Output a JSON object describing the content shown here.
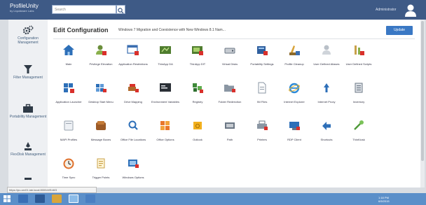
{
  "header": {
    "logo_title": "ProfileUnity",
    "logo_subtitle": "by Liquidware Labs",
    "search_placeholder": "Search",
    "user_name": "Administrator"
  },
  "sidebar": {
    "items": [
      {
        "label": "Configuration Management",
        "icon": "gears-icon"
      },
      {
        "label": "Filter Management",
        "icon": "filter-icon"
      },
      {
        "label": "Portability Management",
        "icon": "briefcase-icon"
      },
      {
        "label": "FlexDisk Management",
        "icon": "flexdisk-icon"
      },
      {
        "label": "",
        "icon": "more-icon"
      }
    ]
  },
  "main": {
    "title": "Edit Configuration",
    "subtitle": "Windows 7 Migration and Coexistence with New Windows 8.1 Nam...",
    "update_label": "Update",
    "tiles": [
      {
        "label": "Main",
        "icon": "house-icon"
      },
      {
        "label": "Privilege Elevation",
        "icon": "privilege-elevation-icon"
      },
      {
        "label": "Application Restrictions",
        "icon": "application-restrictions-icon"
      },
      {
        "label": "ThinApp DA",
        "icon": "thinapp-icon"
      },
      {
        "label": "ThinApp DIT",
        "icon": "thinapp-dit-icon"
      },
      {
        "label": "Virtual Disks",
        "icon": "virtual-disk-icon"
      },
      {
        "label": "Portability Settings",
        "icon": "portability-settings-icon"
      },
      {
        "label": "Profile Cleanup",
        "icon": "profile-cleanup-icon"
      },
      {
        "label": "User Defined Aliases",
        "icon": "user-defined-aliases-icon"
      },
      {
        "label": "User Defined Scripts",
        "icon": "user-defined-scripts-icon"
      },
      {
        "label": "Application Launcher",
        "icon": "application-launcher-icon"
      },
      {
        "label": "Desktop Start Menu",
        "icon": "desktop-start-menu-icon"
      },
      {
        "label": "Drive Mapping",
        "icon": "drive-mapping-icon"
      },
      {
        "label": "Environment Variables",
        "icon": "environment-variables-icon"
      },
      {
        "label": "Registry",
        "icon": "registry-icon"
      },
      {
        "label": "Folder Redirection",
        "icon": "folder-redirection-icon"
      },
      {
        "label": "INI Files",
        "icon": "ini-files-icon"
      },
      {
        "label": "Internet Explorer",
        "icon": "internet-explorer-icon"
      },
      {
        "label": "Internet Proxy",
        "icon": "internet-proxy-icon"
      },
      {
        "label": "Inventory",
        "icon": "inventory-icon"
      },
      {
        "label": "MAPI Profiles",
        "icon": "mapi-profiles-icon"
      },
      {
        "label": "Message Boxes",
        "icon": "message-boxes-icon"
      },
      {
        "label": "Office File Locations",
        "icon": "office-file-locations-icon"
      },
      {
        "label": "Office Options",
        "icon": "office-options-icon"
      },
      {
        "label": "Outlook",
        "icon": "outlook-icon"
      },
      {
        "label": "Path",
        "icon": "path-icon"
      },
      {
        "label": "Printers",
        "icon": "printers-icon"
      },
      {
        "label": "RDP Client",
        "icon": "rdp-client-icon"
      },
      {
        "label": "Shortcuts",
        "icon": "shortcuts-icon"
      },
      {
        "label": "ThinKiosk",
        "icon": "thinkiosk-icon"
      },
      {
        "label": "Time Sync",
        "icon": "time-sync-icon"
      },
      {
        "label": "Trigger Points",
        "icon": "trigger-points-icon"
      },
      {
        "label": "Windows Options",
        "icon": "windows-options-icon"
      }
    ]
  },
  "status_url": "https://pu-srv01.lab.local:8000/#/Edit/3",
  "tray": {
    "time": "1:18 PM",
    "date": "6/5/2015"
  },
  "colors": {
    "topbar": "#3e5a86",
    "accent": "#3a78c4",
    "taskbar": "#5b8fc9"
  }
}
